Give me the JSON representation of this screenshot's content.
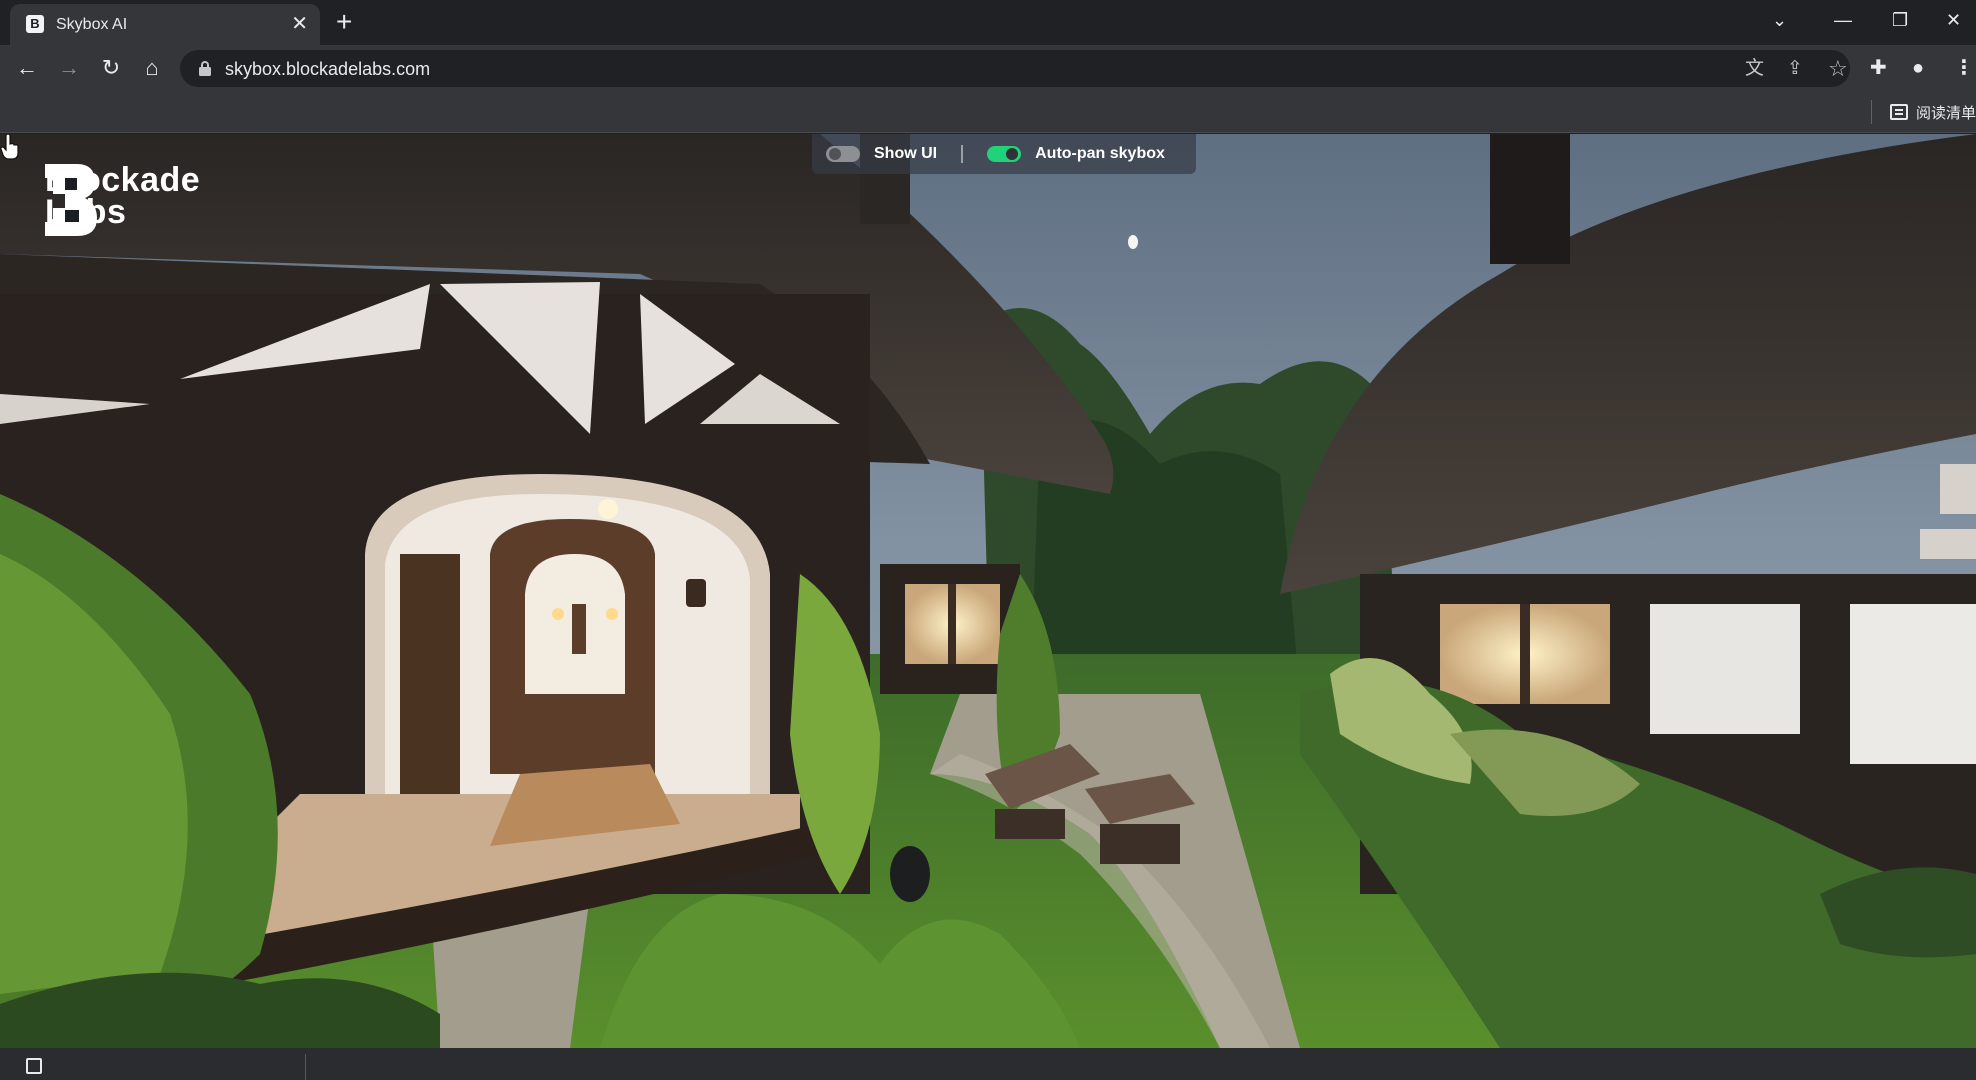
{
  "browser": {
    "tab": {
      "favicon_letter": "B",
      "title": "Skybox AI",
      "close_glyph": "✕"
    },
    "new_tab_glyph": "+",
    "window_controls": {
      "tab_search": "⌄",
      "minimize": "—",
      "restore": "❐",
      "close": "✕"
    },
    "nav": {
      "back": "←",
      "forward": "→",
      "reload": "↻",
      "home": "⌂"
    },
    "address": {
      "url": "skybox.blockadelabs.com"
    },
    "omnibox_icons": {
      "translate": "文",
      "share": "⇪",
      "bookmark": "☆"
    },
    "extensions": {
      "puzzle": "✚",
      "profile": "●",
      "menu": "⋮"
    },
    "reading_list_label": "阅读清单"
  },
  "app": {
    "logo": {
      "line1": "Blockade",
      "line2": "Labs"
    },
    "controls": {
      "show_ui": {
        "label": "Show UI",
        "enabled": false
      },
      "auto_pan": {
        "label": "Auto-pan skybox",
        "enabled": true
      }
    },
    "colors": {
      "toggle_on": "#22d27a",
      "toggle_off": "#8c8f94"
    }
  },
  "bottom": {
    "text": ""
  }
}
